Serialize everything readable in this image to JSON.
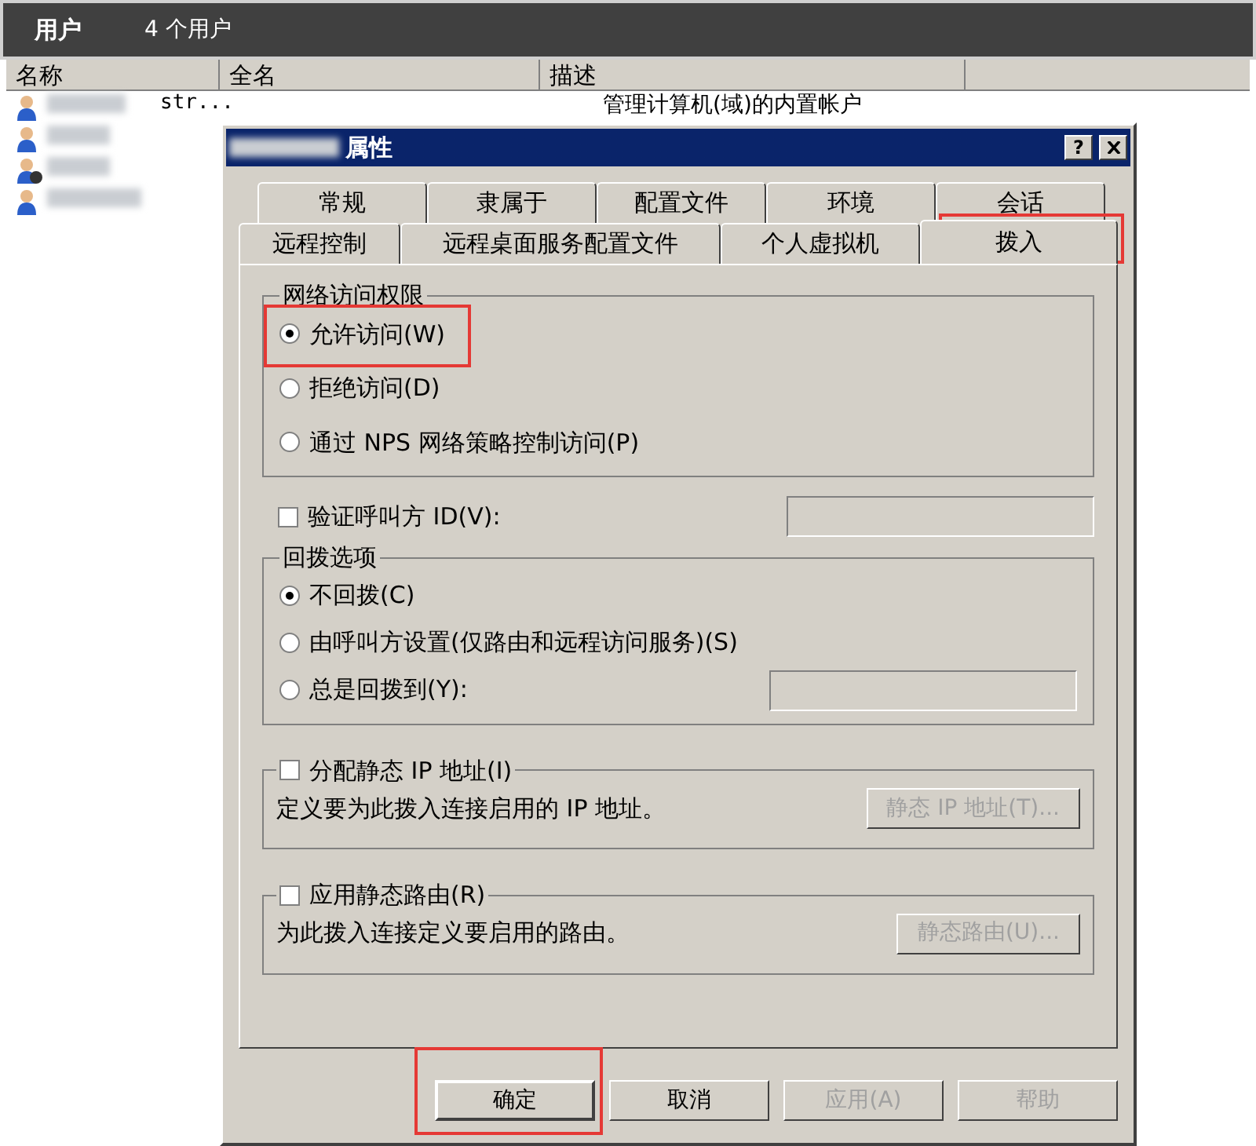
{
  "list_window": {
    "title": "用户",
    "count": "4 个用户",
    "columns": [
      "名称",
      "全名",
      "描述"
    ],
    "users": [
      {
        "name": "str...",
        "description": "管理计算机(域)的内置帐户",
        "disabled": false
      },
      {
        "disabled": false
      },
      {
        "disabled": true
      },
      {
        "disabled": false
      }
    ]
  },
  "dialog": {
    "title": "属性",
    "help_button": "?",
    "tab_rows": [
      [
        {
          "label": "常规",
          "selected": false
        },
        {
          "label": "隶属于",
          "selected": false
        },
        {
          "label": "配置文件",
          "selected": false
        },
        {
          "label": "环境",
          "selected": false
        },
        {
          "label": "会话",
          "selected": false
        }
      ],
      [
        {
          "label": "远程控制",
          "selected": false
        },
        {
          "label": "远程桌面服务配置文件",
          "selected": false
        },
        {
          "label": "个人虚拟机",
          "selected": false
        },
        {
          "label": "拨入",
          "selected": true
        }
      ]
    ],
    "network_access": {
      "title": "网络访问权限",
      "options": [
        {
          "label": "允许访问(W)",
          "selected": true
        },
        {
          "label": "拒绝访问(D)",
          "selected": false
        },
        {
          "label": "通过 NPS 网络策略控制访问(P)",
          "selected": false
        }
      ]
    },
    "verify_caller": {
      "label": "验证呼叫方 ID(V):",
      "checked": false
    },
    "callback": {
      "title": "回拨选项",
      "options": [
        {
          "label": "不回拨(C)",
          "selected": true,
          "kind": "plain"
        },
        {
          "label": "由呼叫方设置(仅路由和远程访问服务)(S)",
          "selected": false,
          "kind": "plain"
        },
        {
          "label": "总是回拨到(Y):",
          "selected": false,
          "kind": "field"
        }
      ]
    },
    "static_ip": {
      "label": "分配静态 IP 地址(I)",
      "checked": false,
      "description": "定义要为此拨入连接启用的 IP 地址。",
      "button": {
        "label": "静态 IP 地址(T)...",
        "disabled": true
      }
    },
    "static_routes": {
      "label": "应用静态路由(R)",
      "checked": false,
      "description": "为此拨入连接定义要启用的路由。",
      "button": {
        "label": "静态路由(U)...",
        "disabled": true
      }
    },
    "buttons": [
      {
        "label": "确定",
        "disabled": false
      },
      {
        "label": "取消",
        "disabled": false
      },
      {
        "label": "应用(A)",
        "disabled": true
      },
      {
        "label": "帮助",
        "disabled": true
      }
    ]
  }
}
